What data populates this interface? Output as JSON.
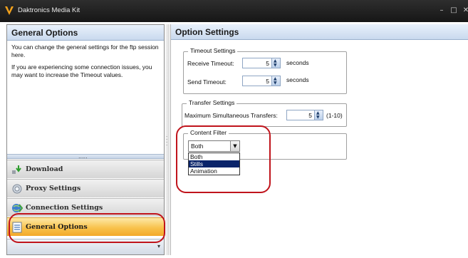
{
  "window": {
    "title": "Daktronics Media Kit",
    "controls": [
      "–",
      "□",
      "✕"
    ]
  },
  "left_pane": {
    "header": "General Options",
    "description": [
      "You can change the general settings for the ftp session here.",
      "If you are experiencing some connection issues, you may want to increase the Timeout values."
    ],
    "nav_items": [
      {
        "label": "Download",
        "icon": "download-icon",
        "active": false
      },
      {
        "label": "Proxy Settings",
        "icon": "proxy-icon",
        "active": false
      },
      {
        "label": "Connection Settings",
        "icon": "connection-icon",
        "active": false
      },
      {
        "label": "General Options",
        "icon": "general-options-icon",
        "active": true
      }
    ]
  },
  "right_pane": {
    "header": "Option Settings",
    "timeout": {
      "legend": "Timeout Settings",
      "receive_label": "Receive Timeout:",
      "receive_value": "5",
      "receive_unit": "seconds",
      "send_label": "Send Timeout:",
      "send_value": "5",
      "send_unit": "seconds"
    },
    "transfer": {
      "legend": "Transfer Settings",
      "max_label": "Maximum Simultaneous Transfers:",
      "max_value": "5",
      "range": "(1-10)"
    },
    "content_filter": {
      "legend": "Content Filter",
      "selected": "Both",
      "options": [
        "Both",
        "Stills",
        "Animation"
      ],
      "highlighted": "Stills"
    }
  },
  "colors": {
    "active_nav": "#f8c24c",
    "annotation": "#c0141c",
    "highlight": "#0a246a"
  }
}
